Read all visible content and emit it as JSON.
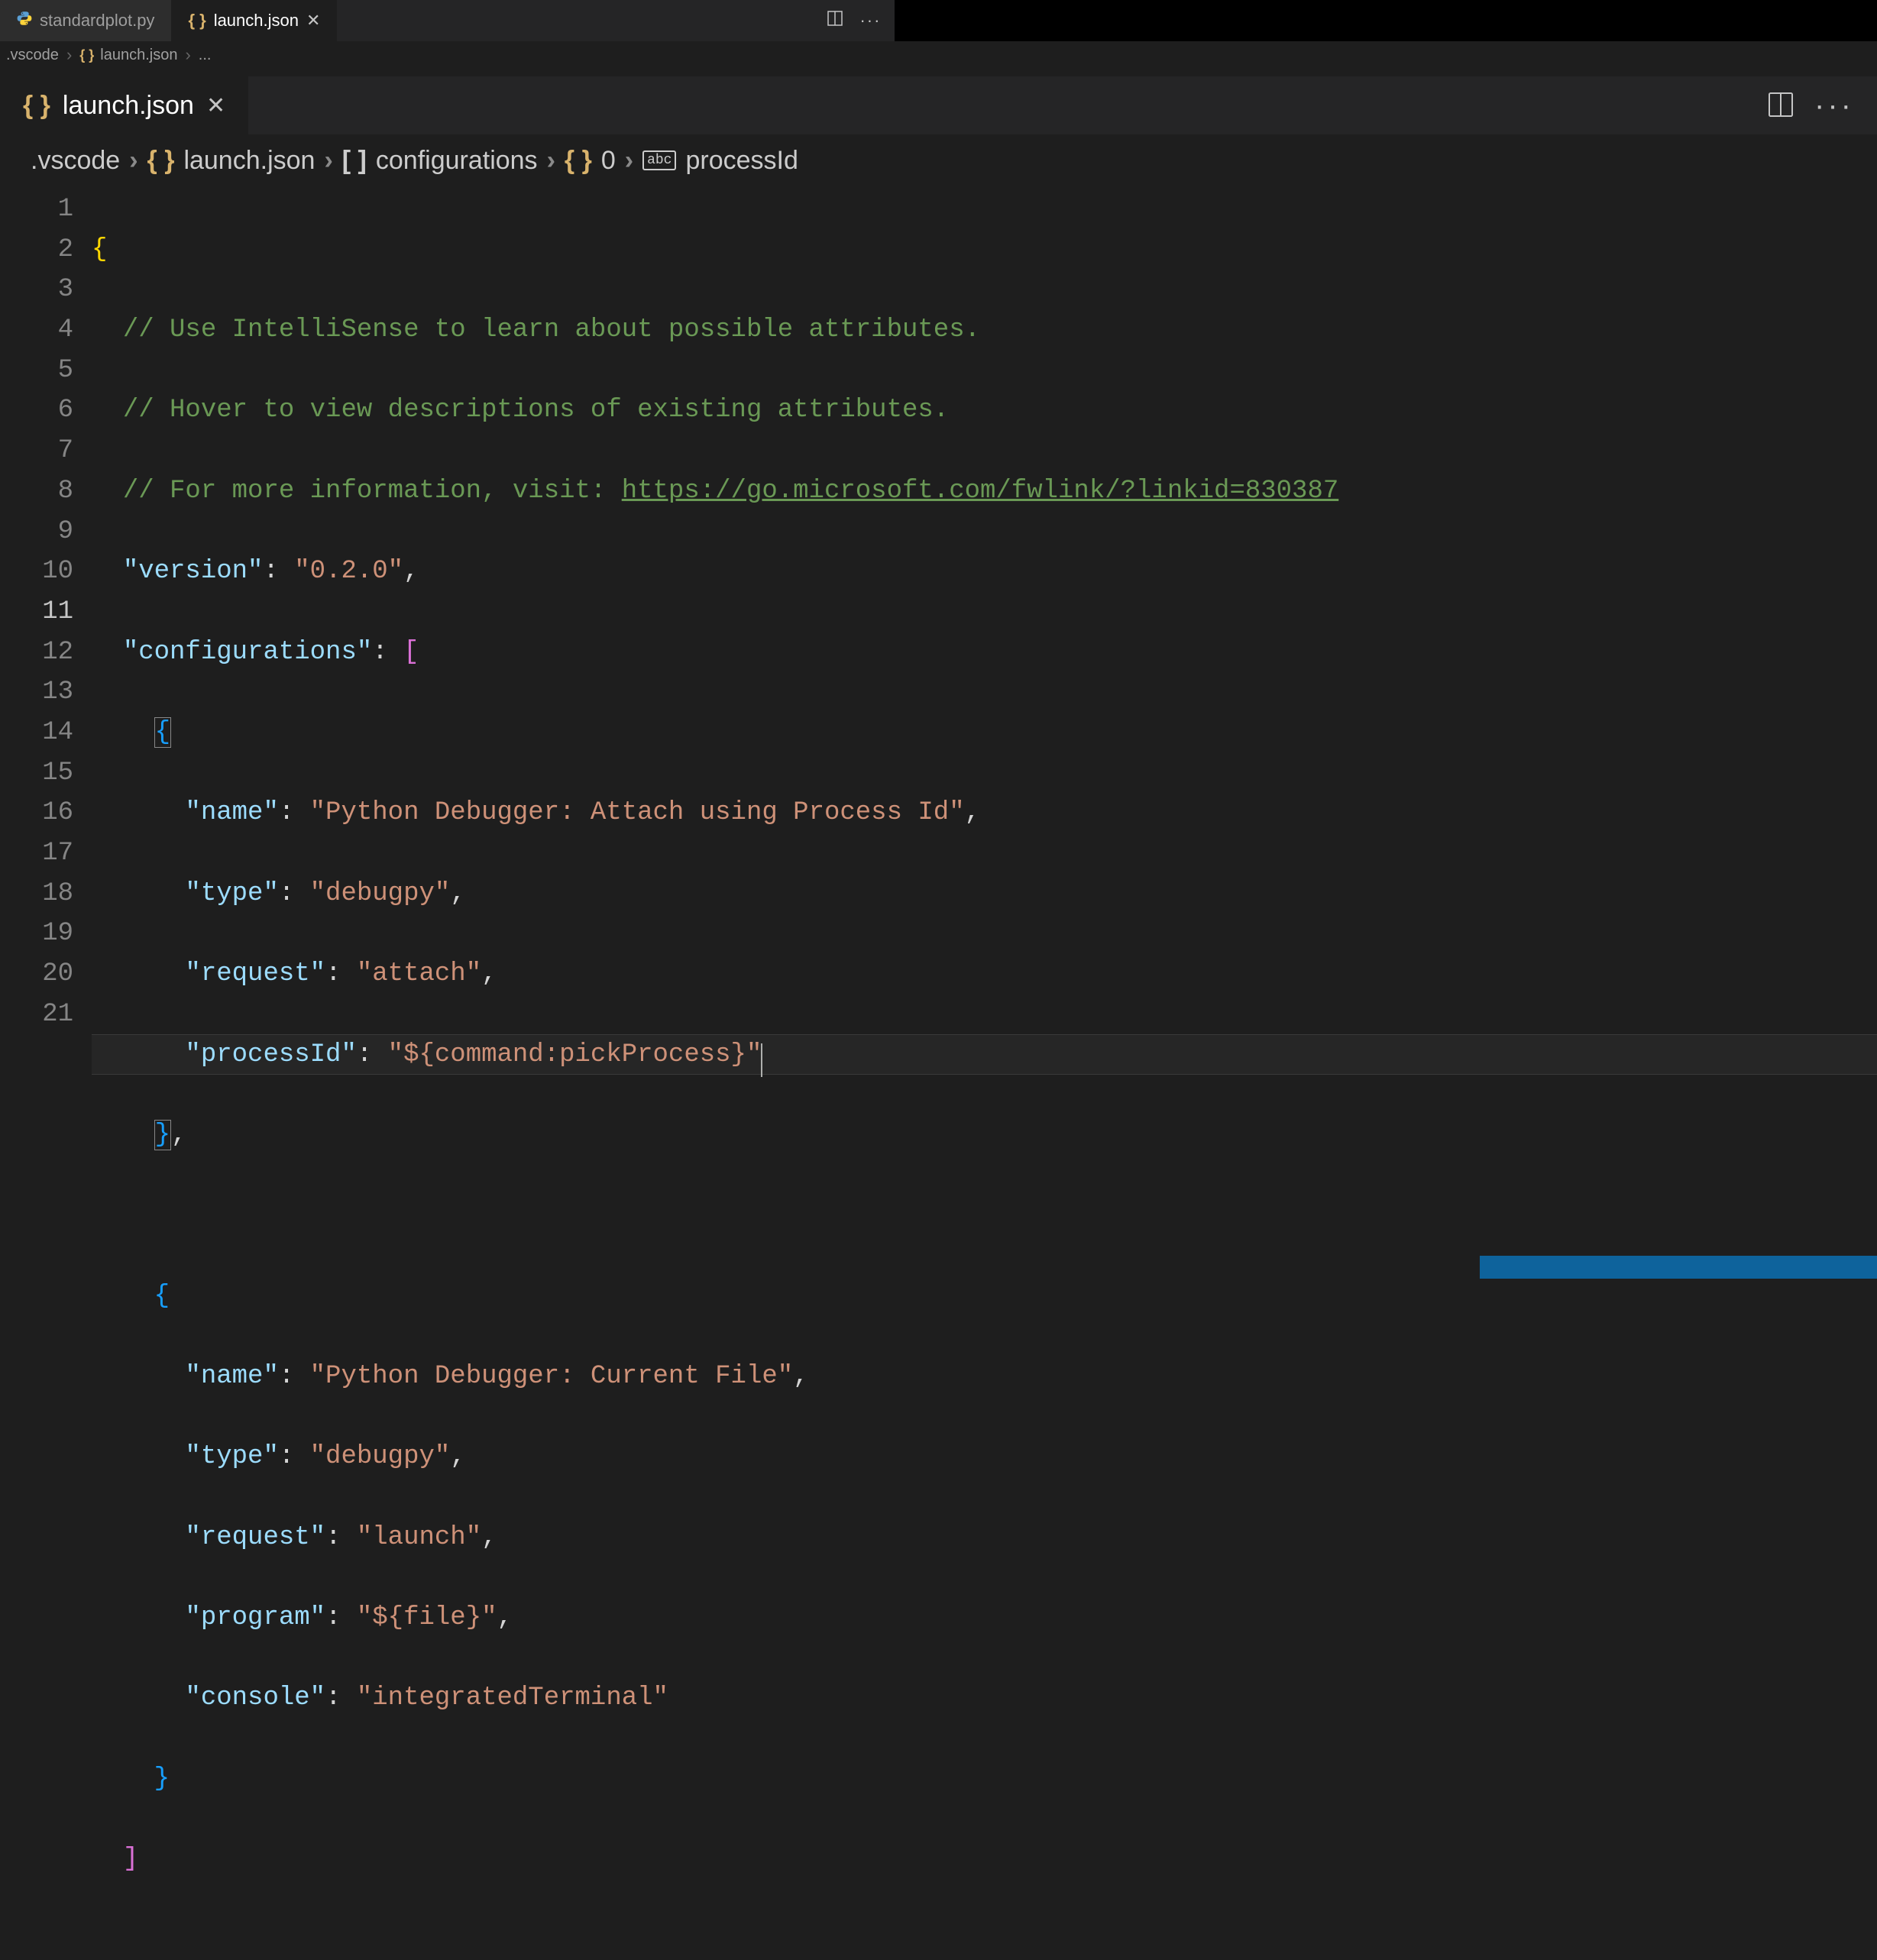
{
  "outer_tabs": {
    "tab1": {
      "label": "standardplot.py"
    },
    "tab2": {
      "label": "launch.json"
    }
  },
  "outer_breadcrumb": {
    "root": ".vscode",
    "file": "launch.json",
    "tail": "..."
  },
  "inner_tab": {
    "label": "launch.json"
  },
  "inner_breadcrumb": {
    "seg1": ".vscode",
    "seg2": "launch.json",
    "seg3": "configurations",
    "seg4": "0",
    "seg5": "processId"
  },
  "icons": {
    "json_braces": "{ }",
    "array": "[  ]",
    "abc": "abc",
    "close": "✕",
    "more": "···"
  },
  "line_numbers": [
    "1",
    "2",
    "3",
    "4",
    "5",
    "6",
    "7",
    "8",
    "9",
    "10",
    "11",
    "12",
    "13",
    "14",
    "15",
    "16",
    "17",
    "18",
    "19",
    "20",
    "21"
  ],
  "current_line": 11,
  "code": {
    "l1": {
      "brace": "{"
    },
    "l2": {
      "comment": "// Use IntelliSense to learn about possible attributes."
    },
    "l3": {
      "comment": "// Hover to view descriptions of existing attributes."
    },
    "l4": {
      "comment_pre": "// For more information, visit: ",
      "link": "https://go.microsoft.com/fwlink/?linkid=830387"
    },
    "l5": {
      "key": "\"version\"",
      "val": "\"0.2.0\"",
      "trail": ","
    },
    "l6": {
      "key": "\"configurations\"",
      "bracket": "[",
      "colon_sp": ": "
    },
    "l7": {
      "brace": "{"
    },
    "l8": {
      "key": "\"name\"",
      "val": "\"Python Debugger: Attach using Process Id\"",
      "trail": ","
    },
    "l9": {
      "key": "\"type\"",
      "val": "\"debugpy\"",
      "trail": ","
    },
    "l10": {
      "key": "\"request\"",
      "val": "\"attach\"",
      "trail": ","
    },
    "l11": {
      "key": "\"processId\"",
      "val": "\"${command:pickProcess}\""
    },
    "l12": {
      "brace": "}",
      "trail": ","
    },
    "l14": {
      "brace": "{"
    },
    "l15": {
      "key": "\"name\"",
      "val": "\"Python Debugger: Current File\"",
      "trail": ","
    },
    "l16": {
      "key": "\"type\"",
      "val": "\"debugpy\"",
      "trail": ","
    },
    "l17": {
      "key": "\"request\"",
      "val": "\"launch\"",
      "trail": ","
    },
    "l18": {
      "key": "\"program\"",
      "val": "\"${file}\"",
      "trail": ","
    },
    "l19": {
      "key": "\"console\"",
      "val": "\"integratedTerminal\""
    },
    "l20": {
      "brace": "}"
    },
    "l21": {
      "bracket": "]"
    }
  },
  "colors": {
    "background": "#1e1e1e",
    "comment": "#6a9955",
    "key": "#9cdcfe",
    "string": "#ce9178"
  }
}
